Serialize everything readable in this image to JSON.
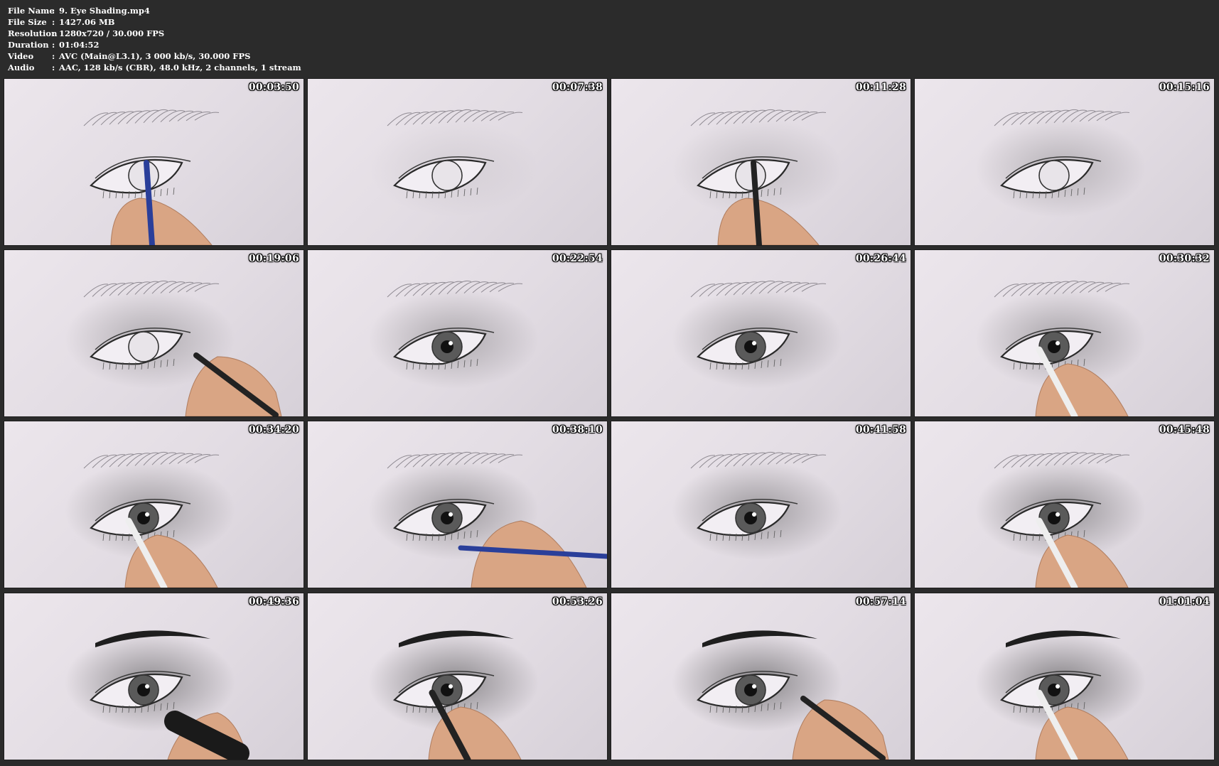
{
  "info": {
    "rows": [
      {
        "label": "File Name",
        "sep": ":",
        "value": "9. Eye Shading.mp4"
      },
      {
        "label": "File Size",
        "sep": ":",
        "value": "1427.06 MB"
      },
      {
        "label": "Resolution",
        "sep": ":",
        "value": "1280x720 / 30.000 FPS"
      },
      {
        "label": "Duration",
        "sep": ":",
        "value": "01:04:52"
      },
      {
        "label": "Video",
        "sep": ":",
        "value": "AVC (Main@L3.1), 3 000 kb/s, 30.000 FPS"
      },
      {
        "label": "Audio",
        "sep": ":",
        "value": "AAC, 128 kb/s (CBR), 48.0 kHz, 2 channels, 1 stream"
      }
    ]
  },
  "thumbnails": [
    {
      "timestamp": "00:03:50",
      "shade": 0,
      "brow": "light",
      "pupil": false,
      "hand": "pencil",
      "hand_color": "#2a3f9a"
    },
    {
      "timestamp": "00:07:38",
      "shade": 0.15,
      "brow": "light",
      "pupil": false,
      "hand": "none"
    },
    {
      "timestamp": "00:11:28",
      "shade": 0.3,
      "brow": "light",
      "pupil": false,
      "hand": "pencil",
      "hand_color": "#222222"
    },
    {
      "timestamp": "00:15:16",
      "shade": 0.45,
      "brow": "light",
      "pupil": false,
      "hand": "none"
    },
    {
      "timestamp": "00:19:06",
      "shade": 0.5,
      "brow": "light",
      "pupil": false,
      "hand": "pencil-right",
      "hand_color": "#222222"
    },
    {
      "timestamp": "00:22:54",
      "shade": 0.55,
      "brow": "light",
      "pupil": true,
      "hand": "none"
    },
    {
      "timestamp": "00:26:44",
      "shade": 0.6,
      "brow": "light",
      "pupil": true,
      "hand": "none"
    },
    {
      "timestamp": "00:30:32",
      "shade": 0.6,
      "brow": "light",
      "pupil": true,
      "hand": "pencil-low",
      "hand_color": "#eeeeee"
    },
    {
      "timestamp": "00:34:20",
      "shade": 0.65,
      "brow": "light",
      "pupil": true,
      "hand": "pencil-low",
      "hand_color": "#eeeeee"
    },
    {
      "timestamp": "00:38:10",
      "shade": 0.7,
      "brow": "light",
      "pupil": true,
      "hand": "pencil-long",
      "hand_color": "#2a3f9a"
    },
    {
      "timestamp": "00:41:58",
      "shade": 0.7,
      "brow": "light",
      "pupil": true,
      "hand": "none"
    },
    {
      "timestamp": "00:45:48",
      "shade": 0.8,
      "brow": "light",
      "pupil": true,
      "hand": "pencil-low",
      "hand_color": "#eeeeee"
    },
    {
      "timestamp": "00:49:36",
      "shade": 0.85,
      "brow": "dark",
      "pupil": true,
      "hand": "eraser",
      "hand_color": "#1a1a1a"
    },
    {
      "timestamp": "00:53:26",
      "shade": 0.9,
      "brow": "dark",
      "pupil": true,
      "hand": "pencil-low",
      "hand_color": "#222222"
    },
    {
      "timestamp": "00:57:14",
      "shade": 0.95,
      "brow": "dark",
      "pupil": true,
      "hand": "pencil-right",
      "hand_color": "#222222"
    },
    {
      "timestamp": "01:01:04",
      "shade": 0.95,
      "brow": "dark",
      "pupil": true,
      "hand": "pencil-low",
      "hand_color": "#eeeeee"
    }
  ]
}
